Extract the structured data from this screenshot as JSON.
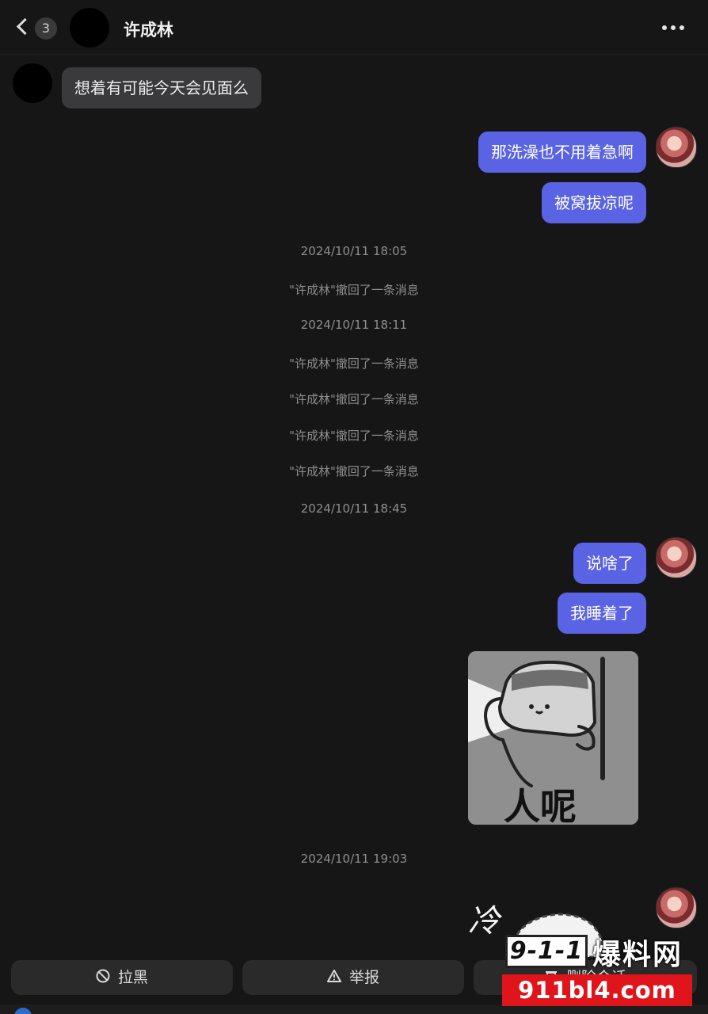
{
  "header": {
    "unread_count": "3",
    "title": "许成林"
  },
  "messages": {
    "m1": "想着有可能今天会见面么",
    "m2": "那洗澡也不用着急啊",
    "m3": "被窝拔凉呢",
    "m4": "说啥了",
    "m5": "我睡着了"
  },
  "system": {
    "t1": "2024/10/11 18:05",
    "r1": "\"许成林\"撤回了一条消息",
    "t2": "2024/10/11 18:11",
    "r2": "\"许成林\"撤回了一条消息",
    "r3": "\"许成林\"撤回了一条消息",
    "r4": "\"许成林\"撤回了一条消息",
    "r5": "\"许成林\"撤回了一条消息",
    "t3": "2024/10/11 18:45",
    "t4": "2024/10/11 19:03"
  },
  "sticker": {
    "caption": "人呢"
  },
  "sticker2": {
    "caption": "冷"
  },
  "actions": {
    "block_label": "拉黑",
    "report_label": "举报",
    "delete_label": "删除会话"
  },
  "watermark": {
    "number": "9-1-1",
    "brand": "爆料网",
    "domain": "911bl4.com"
  },
  "colors": {
    "background": "#161616",
    "incoming_bubble": "#3a3a3c",
    "outgoing_bubble": "#5a63e3",
    "system_text": "#8e8e8e"
  },
  "icons": {
    "back": "chevron-left-icon",
    "more": "more-horizontal-icon",
    "block": "block-circle-icon",
    "report": "warning-triangle-icon",
    "delete": "trash-icon"
  }
}
